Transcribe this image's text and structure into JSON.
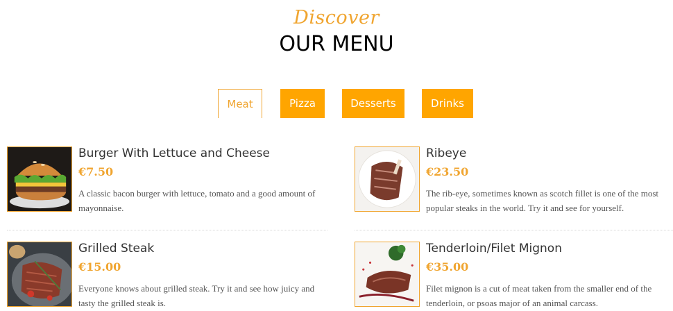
{
  "header": {
    "kicker": "Discover",
    "title": "OUR MENU"
  },
  "tabs": [
    {
      "label": "Meat",
      "active": true
    },
    {
      "label": "Pizza",
      "active": false
    },
    {
      "label": "Desserts",
      "active": false
    },
    {
      "label": "Drinks",
      "active": false
    }
  ],
  "menu": [
    {
      "name": "Burger With Lettuce and Cheese",
      "price": "€7.50",
      "description": "A classic bacon burger with lettuce, tomato and a good amount of mayonnaise.",
      "icon": "burger-photo"
    },
    {
      "name": "Ribeye",
      "price": "€23.50",
      "description": "The rib-eye, sometimes known as scotch fillet is one of the most popular steaks in the world. Try it and see for yourself.",
      "icon": "ribeye-photo"
    },
    {
      "name": "Grilled Steak",
      "price": "€15.00",
      "description": "Everyone knows about grilled steak. Try it and see how juicy and tasty the grilled steak is.",
      "icon": "grilled-steak-photo"
    },
    {
      "name": "Tenderloin/Filet Mignon",
      "price": "€35.00",
      "description": "Filet mignon is a cut of meat taken from the smaller end of the tenderloin, or psoas major of an animal carcass.",
      "icon": "filet-mignon-photo"
    }
  ],
  "colors": {
    "accent": "#f0a530",
    "tab_fill": "#ffa500",
    "text": "#333333",
    "muted": "#555555"
  }
}
